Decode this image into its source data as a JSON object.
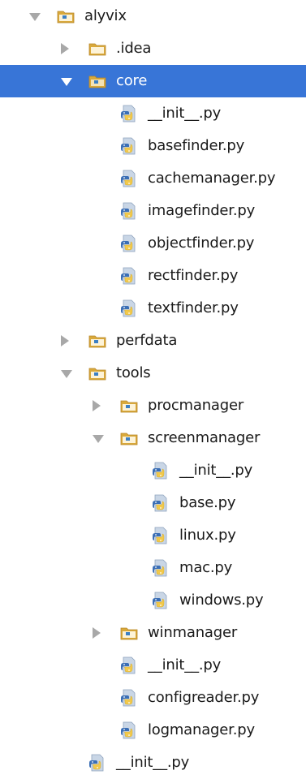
{
  "tree": {
    "nodes": [
      {
        "label": "alyvix",
        "kind": "folder",
        "depth": 0,
        "state": "expanded",
        "selected": false
      },
      {
        "label": ".idea",
        "kind": "folder-plain",
        "depth": 1,
        "state": "collapsed",
        "selected": false
      },
      {
        "label": "core",
        "kind": "folder",
        "depth": 1,
        "state": "expanded",
        "selected": true
      },
      {
        "label": "__init__.py",
        "kind": "python-file",
        "depth": 2,
        "state": "leaf",
        "selected": false
      },
      {
        "label": "basefinder.py",
        "kind": "python-file",
        "depth": 2,
        "state": "leaf",
        "selected": false
      },
      {
        "label": "cachemanager.py",
        "kind": "python-file",
        "depth": 2,
        "state": "leaf",
        "selected": false
      },
      {
        "label": "imagefinder.py",
        "kind": "python-file",
        "depth": 2,
        "state": "leaf",
        "selected": false
      },
      {
        "label": "objectfinder.py",
        "kind": "python-file",
        "depth": 2,
        "state": "leaf",
        "selected": false
      },
      {
        "label": "rectfinder.py",
        "kind": "python-file",
        "depth": 2,
        "state": "leaf",
        "selected": false
      },
      {
        "label": "textfinder.py",
        "kind": "python-file",
        "depth": 2,
        "state": "leaf",
        "selected": false
      },
      {
        "label": "perfdata",
        "kind": "folder",
        "depth": 1,
        "state": "collapsed",
        "selected": false
      },
      {
        "label": "tools",
        "kind": "folder",
        "depth": 1,
        "state": "expanded",
        "selected": false
      },
      {
        "label": "procmanager",
        "kind": "folder",
        "depth": 2,
        "state": "collapsed",
        "selected": false
      },
      {
        "label": "screenmanager",
        "kind": "folder",
        "depth": 2,
        "state": "expanded",
        "selected": false
      },
      {
        "label": "__init__.py",
        "kind": "python-file",
        "depth": 3,
        "state": "leaf",
        "selected": false
      },
      {
        "label": "base.py",
        "kind": "python-file",
        "depth": 3,
        "state": "leaf",
        "selected": false
      },
      {
        "label": "linux.py",
        "kind": "python-file",
        "depth": 3,
        "state": "leaf",
        "selected": false
      },
      {
        "label": "mac.py",
        "kind": "python-file",
        "depth": 3,
        "state": "leaf",
        "selected": false
      },
      {
        "label": "windows.py",
        "kind": "python-file",
        "depth": 3,
        "state": "leaf",
        "selected": false
      },
      {
        "label": "winmanager",
        "kind": "folder",
        "depth": 2,
        "state": "collapsed",
        "selected": false
      },
      {
        "label": "__init__.py",
        "kind": "python-file",
        "depth": 2,
        "state": "leaf",
        "selected": false
      },
      {
        "label": "configreader.py",
        "kind": "python-file",
        "depth": 2,
        "state": "leaf",
        "selected": false
      },
      {
        "label": "logmanager.py",
        "kind": "python-file",
        "depth": 2,
        "state": "leaf",
        "selected": false
      },
      {
        "label": "__init__.py",
        "kind": "python-file",
        "depth": 1,
        "state": "leaf",
        "selected": false
      }
    ]
  },
  "colors": {
    "selection": "#3875d7",
    "arrow": "#a8a8a8",
    "folder": "#d9a93b",
    "folder_dot": "#3b7fc4",
    "python_blue": "#3b6fb6",
    "python_yellow": "#f2c94c",
    "file_page": "#c9d6e6"
  },
  "icons": {
    "folder": "folder-icon",
    "folder-plain": "folder-icon",
    "python-file": "python-file-icon",
    "expanded": "triangle-down-icon",
    "collapsed": "triangle-right-icon"
  }
}
